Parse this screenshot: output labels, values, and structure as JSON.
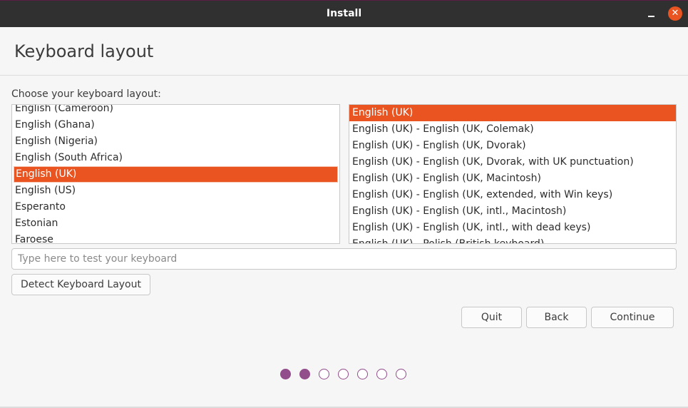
{
  "window": {
    "title": "Install",
    "minimize_icon": "minimize-icon",
    "close_icon": "close-icon",
    "close_glyph": "✕"
  },
  "page": {
    "title": "Keyboard layout",
    "choose_label": "Choose your keyboard layout:"
  },
  "layouts": {
    "items": [
      "English (Cameroon)",
      "English (Ghana)",
      "English (Nigeria)",
      "English (South Africa)",
      "English (UK)",
      "English (US)",
      "Esperanto",
      "Estonian",
      "Faroese"
    ],
    "selected": "English (UK)"
  },
  "variants": {
    "items": [
      "English (UK)",
      "English (UK) - English (UK, Colemak)",
      "English (UK) - English (UK, Dvorak)",
      "English (UK) - English (UK, Dvorak, with UK punctuation)",
      "English (UK) - English (UK, Macintosh)",
      "English (UK) - English (UK, extended, with Win keys)",
      "English (UK) - English (UK, intl., Macintosh)",
      "English (UK) - English (UK, intl., with dead keys)",
      "English (UK) - Polish (British keyboard)"
    ],
    "selected": "English (UK)"
  },
  "test_input": {
    "value": "",
    "placeholder": "Type here to test your keyboard"
  },
  "buttons": {
    "detect": "Detect Keyboard Layout",
    "quit": "Quit",
    "back": "Back",
    "continue": "Continue"
  },
  "progress": {
    "total_steps": 7,
    "completed_steps": 2
  },
  "colors": {
    "accent": "#e95420",
    "progress": "#924d8b",
    "titlebar": "#303030"
  }
}
